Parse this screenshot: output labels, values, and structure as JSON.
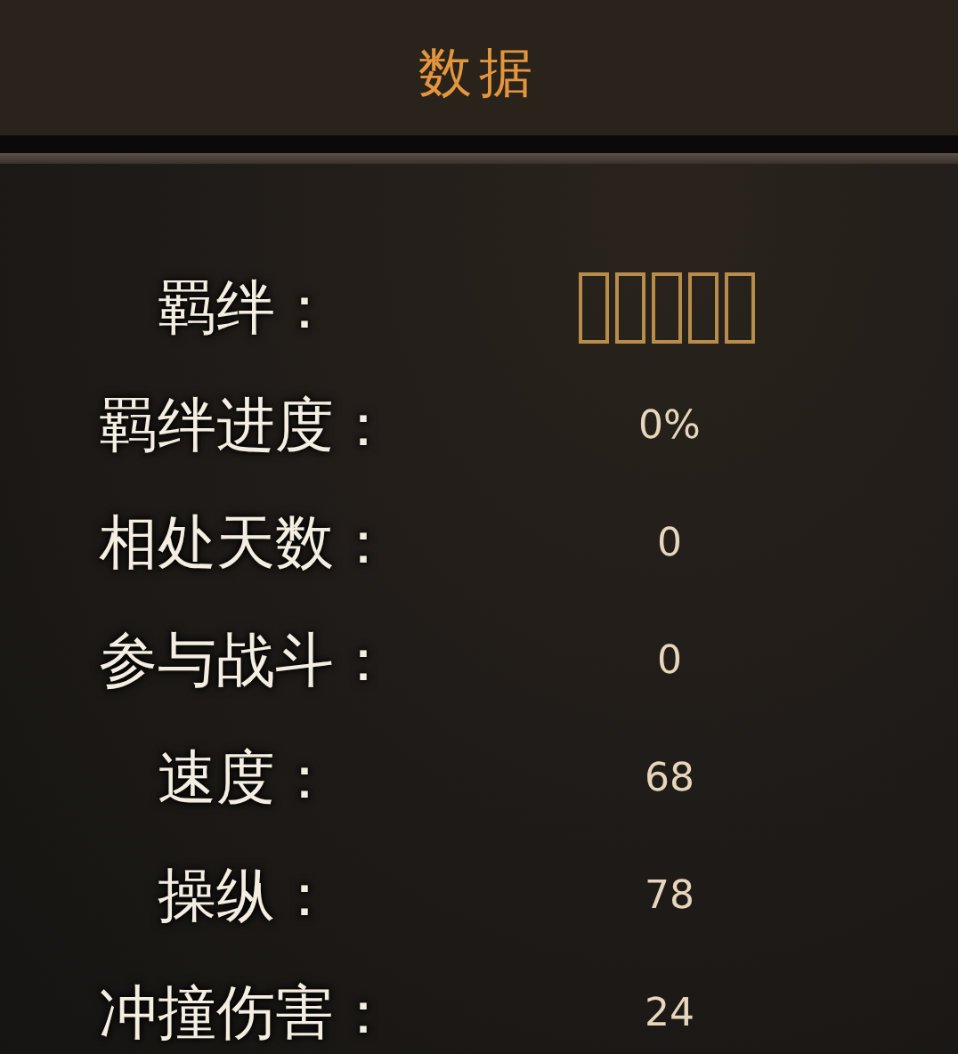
{
  "title": "数据",
  "rows": [
    {
      "label": "羁绊：",
      "kind": "boxes"
    },
    {
      "label": "羁绊进度：",
      "kind": "text",
      "value": "0%"
    },
    {
      "label": "相处天数：",
      "kind": "text",
      "value": "0"
    },
    {
      "label": "参与战斗：",
      "kind": "text",
      "value": "0"
    },
    {
      "label": "速度：",
      "kind": "text",
      "value": "68"
    },
    {
      "label": "操纵：",
      "kind": "text",
      "value": "78"
    },
    {
      "label": "冲撞伤害：",
      "kind": "text",
      "value": "24"
    }
  ]
}
